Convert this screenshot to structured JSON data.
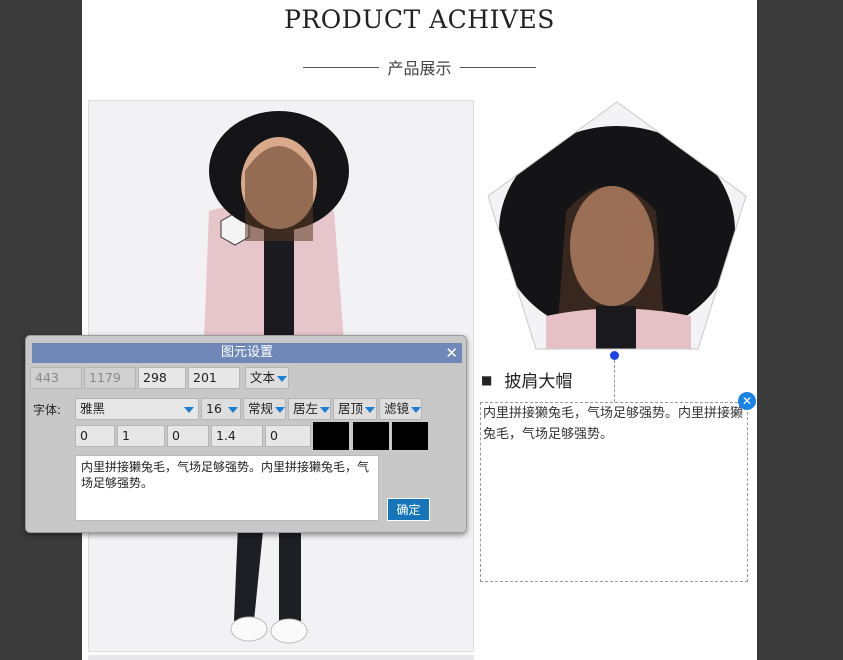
{
  "page": {
    "title": "PRODUCT ACHIVES",
    "subtitle": "产品展示"
  },
  "product": {
    "heading": "披肩大帽",
    "description": "内里拼接獭兔毛，气场足够强势。内里拼接獭兔毛，气场足够强势。"
  },
  "dialog": {
    "title": "图元设置",
    "x": "443",
    "y": "1179",
    "width": "298",
    "height": "201",
    "type_select": "文本",
    "font_label": "字体:",
    "font_family": "雅黑",
    "font_size": "16",
    "font_weight": "常规",
    "align_h": "居左",
    "align_v": "居顶",
    "filter": "滤镜",
    "params": [
      "0",
      "1",
      "0",
      "1.4",
      "0"
    ],
    "swatch_colors": [
      "#000000",
      "#000000",
      "#000000"
    ],
    "text_value": "内里拼接獭兔毛，气场足够强势。内里拼接獭兔毛，气场足够强势。",
    "confirm_label": "确定"
  },
  "colors": {
    "dialog_title_bg": "#6f88b7",
    "confirm_bg": "#1575b8",
    "accent_blue": "#1a84e6"
  }
}
